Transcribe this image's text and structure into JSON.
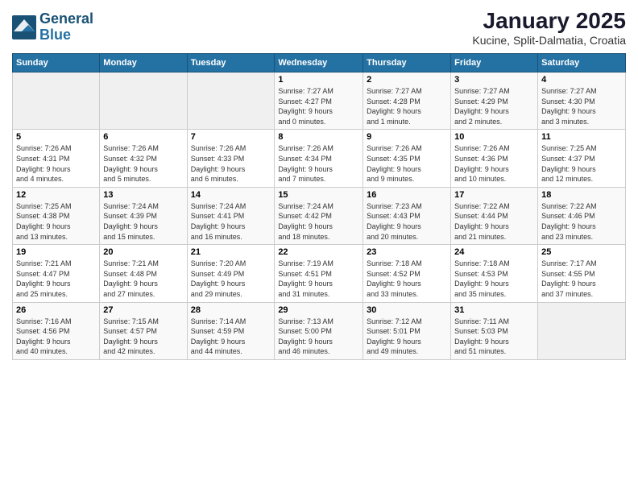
{
  "header": {
    "logo_line1": "General",
    "logo_line2": "Blue",
    "title": "January 2025",
    "subtitle": "Kucine, Split-Dalmatia, Croatia"
  },
  "weekdays": [
    "Sunday",
    "Monday",
    "Tuesday",
    "Wednesday",
    "Thursday",
    "Friday",
    "Saturday"
  ],
  "weeks": [
    [
      {
        "day": "",
        "info": ""
      },
      {
        "day": "",
        "info": ""
      },
      {
        "day": "",
        "info": ""
      },
      {
        "day": "1",
        "info": "Sunrise: 7:27 AM\nSunset: 4:27 PM\nDaylight: 9 hours\nand 0 minutes."
      },
      {
        "day": "2",
        "info": "Sunrise: 7:27 AM\nSunset: 4:28 PM\nDaylight: 9 hours\nand 1 minute."
      },
      {
        "day": "3",
        "info": "Sunrise: 7:27 AM\nSunset: 4:29 PM\nDaylight: 9 hours\nand 2 minutes."
      },
      {
        "day": "4",
        "info": "Sunrise: 7:27 AM\nSunset: 4:30 PM\nDaylight: 9 hours\nand 3 minutes."
      }
    ],
    [
      {
        "day": "5",
        "info": "Sunrise: 7:26 AM\nSunset: 4:31 PM\nDaylight: 9 hours\nand 4 minutes."
      },
      {
        "day": "6",
        "info": "Sunrise: 7:26 AM\nSunset: 4:32 PM\nDaylight: 9 hours\nand 5 minutes."
      },
      {
        "day": "7",
        "info": "Sunrise: 7:26 AM\nSunset: 4:33 PM\nDaylight: 9 hours\nand 6 minutes."
      },
      {
        "day": "8",
        "info": "Sunrise: 7:26 AM\nSunset: 4:34 PM\nDaylight: 9 hours\nand 7 minutes."
      },
      {
        "day": "9",
        "info": "Sunrise: 7:26 AM\nSunset: 4:35 PM\nDaylight: 9 hours\nand 9 minutes."
      },
      {
        "day": "10",
        "info": "Sunrise: 7:26 AM\nSunset: 4:36 PM\nDaylight: 9 hours\nand 10 minutes."
      },
      {
        "day": "11",
        "info": "Sunrise: 7:25 AM\nSunset: 4:37 PM\nDaylight: 9 hours\nand 12 minutes."
      }
    ],
    [
      {
        "day": "12",
        "info": "Sunrise: 7:25 AM\nSunset: 4:38 PM\nDaylight: 9 hours\nand 13 minutes."
      },
      {
        "day": "13",
        "info": "Sunrise: 7:24 AM\nSunset: 4:39 PM\nDaylight: 9 hours\nand 15 minutes."
      },
      {
        "day": "14",
        "info": "Sunrise: 7:24 AM\nSunset: 4:41 PM\nDaylight: 9 hours\nand 16 minutes."
      },
      {
        "day": "15",
        "info": "Sunrise: 7:24 AM\nSunset: 4:42 PM\nDaylight: 9 hours\nand 18 minutes."
      },
      {
        "day": "16",
        "info": "Sunrise: 7:23 AM\nSunset: 4:43 PM\nDaylight: 9 hours\nand 20 minutes."
      },
      {
        "day": "17",
        "info": "Sunrise: 7:22 AM\nSunset: 4:44 PM\nDaylight: 9 hours\nand 21 minutes."
      },
      {
        "day": "18",
        "info": "Sunrise: 7:22 AM\nSunset: 4:46 PM\nDaylight: 9 hours\nand 23 minutes."
      }
    ],
    [
      {
        "day": "19",
        "info": "Sunrise: 7:21 AM\nSunset: 4:47 PM\nDaylight: 9 hours\nand 25 minutes."
      },
      {
        "day": "20",
        "info": "Sunrise: 7:21 AM\nSunset: 4:48 PM\nDaylight: 9 hours\nand 27 minutes."
      },
      {
        "day": "21",
        "info": "Sunrise: 7:20 AM\nSunset: 4:49 PM\nDaylight: 9 hours\nand 29 minutes."
      },
      {
        "day": "22",
        "info": "Sunrise: 7:19 AM\nSunset: 4:51 PM\nDaylight: 9 hours\nand 31 minutes."
      },
      {
        "day": "23",
        "info": "Sunrise: 7:18 AM\nSunset: 4:52 PM\nDaylight: 9 hours\nand 33 minutes."
      },
      {
        "day": "24",
        "info": "Sunrise: 7:18 AM\nSunset: 4:53 PM\nDaylight: 9 hours\nand 35 minutes."
      },
      {
        "day": "25",
        "info": "Sunrise: 7:17 AM\nSunset: 4:55 PM\nDaylight: 9 hours\nand 37 minutes."
      }
    ],
    [
      {
        "day": "26",
        "info": "Sunrise: 7:16 AM\nSunset: 4:56 PM\nDaylight: 9 hours\nand 40 minutes."
      },
      {
        "day": "27",
        "info": "Sunrise: 7:15 AM\nSunset: 4:57 PM\nDaylight: 9 hours\nand 42 minutes."
      },
      {
        "day": "28",
        "info": "Sunrise: 7:14 AM\nSunset: 4:59 PM\nDaylight: 9 hours\nand 44 minutes."
      },
      {
        "day": "29",
        "info": "Sunrise: 7:13 AM\nSunset: 5:00 PM\nDaylight: 9 hours\nand 46 minutes."
      },
      {
        "day": "30",
        "info": "Sunrise: 7:12 AM\nSunset: 5:01 PM\nDaylight: 9 hours\nand 49 minutes."
      },
      {
        "day": "31",
        "info": "Sunrise: 7:11 AM\nSunset: 5:03 PM\nDaylight: 9 hours\nand 51 minutes."
      },
      {
        "day": "",
        "info": ""
      }
    ]
  ]
}
